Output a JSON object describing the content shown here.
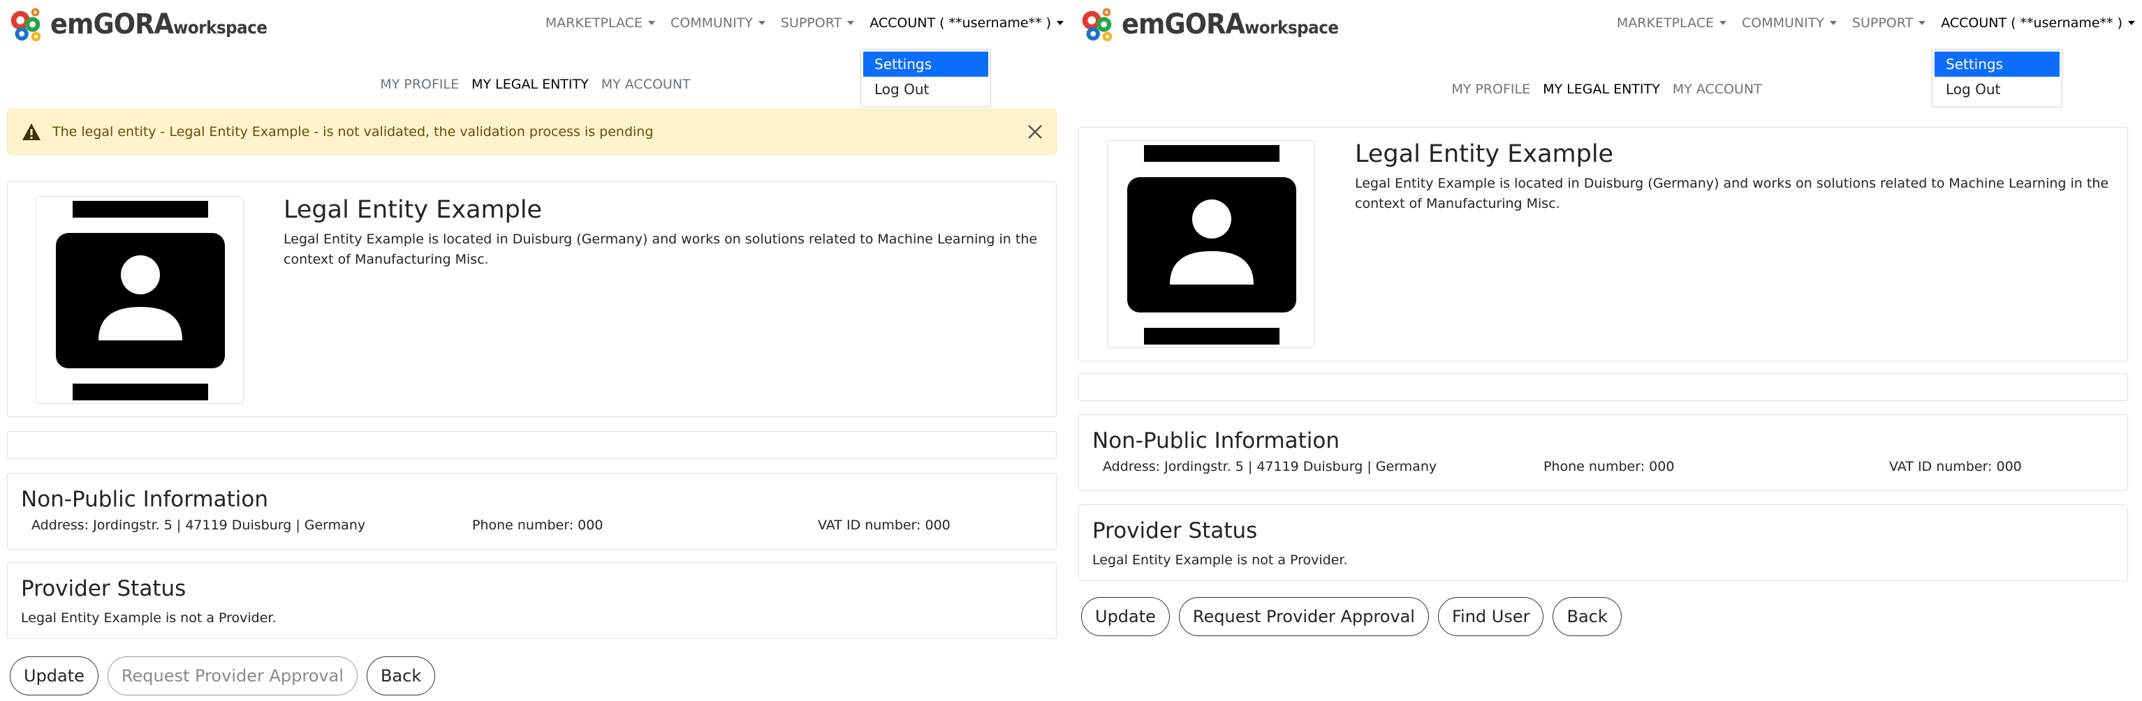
{
  "logo": {
    "brand": "emGORA",
    "suffix": "workspace"
  },
  "nav": {
    "marketplace": "MARKETPLACE",
    "community": "COMMUNITY",
    "support": "SUPPORT",
    "account": "ACCOUNT (  **username**  )"
  },
  "account_menu": {
    "settings": "Settings",
    "logout": "Log Out"
  },
  "tabs": {
    "profile": "MY PROFILE",
    "legal_entity": "MY LEGAL ENTITY",
    "account": "MY ACCOUNT"
  },
  "alert": {
    "text": "The legal entity - Legal Entity Example - is not validated, the validation process is pending"
  },
  "entity": {
    "name": "Legal Entity Example",
    "description": "Legal Entity Example is located in Duisburg (Germany) and works on solutions related to Machine Learning in the context of Manufacturing Misc."
  },
  "non_public": {
    "title": "Non-Public Information",
    "address": "Address: Jordingstr. 5 | 47119 Duisburg | Germany",
    "phone": "Phone number: 000",
    "vat": "VAT ID number: 000"
  },
  "provider": {
    "title": "Provider Status",
    "text": "Legal Entity Example is not a Provider."
  },
  "buttons": {
    "update": "Update",
    "request_provider": "Request Provider Approval",
    "find_user": "Find User",
    "back": "Back"
  },
  "colors": {
    "accent": "#0d6efd",
    "alert_bg": "#fff3cd",
    "alert_text": "#664d03"
  },
  "icons": [
    "gear-logo-icon",
    "caret-down-icon",
    "warning-icon",
    "close-icon",
    "avatar-icon"
  ]
}
